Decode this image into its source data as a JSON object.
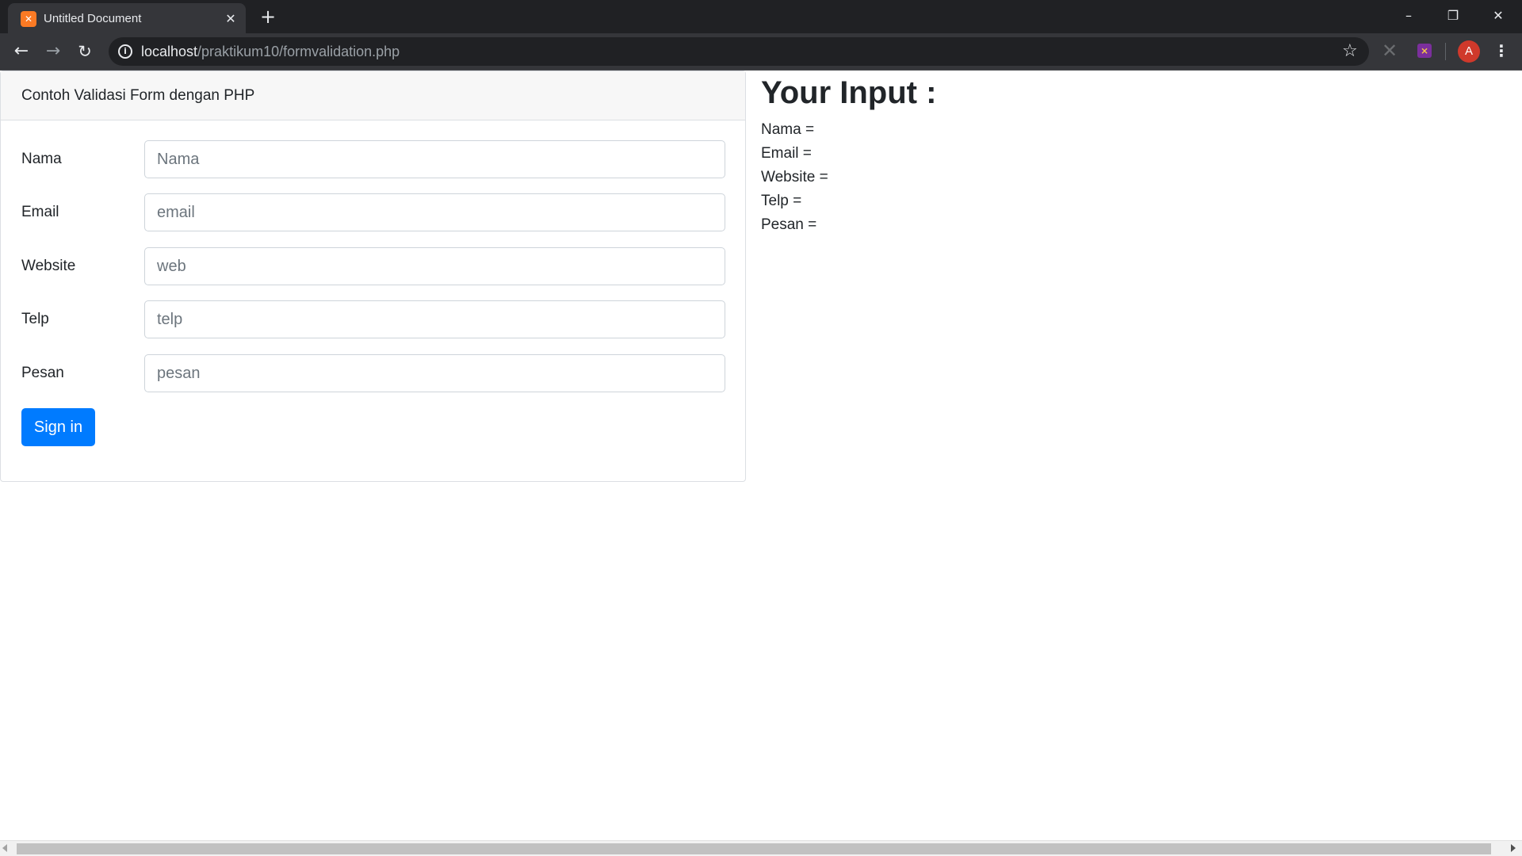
{
  "browser": {
    "tab_title": "Untitled Document",
    "tab_favicon": "xampp-icon",
    "tab_close": "✕",
    "new_tab": "+",
    "url_host": "localhost",
    "url_path": "/praktikum10/formvalidation.php",
    "avatar_letter": "A",
    "icons": {
      "back": "←",
      "forward": "→",
      "reload": "↻",
      "info": "i",
      "star": "☆",
      "extension_x": "✕",
      "menu": "⋮",
      "minimize": "–",
      "maximize": "❐",
      "close": "✕"
    }
  },
  "form": {
    "header_title": "Contoh Validasi Form dengan PHP",
    "fields": [
      {
        "label": "Nama",
        "placeholder": "Nama",
        "value": ""
      },
      {
        "label": "Email",
        "placeholder": "email",
        "value": ""
      },
      {
        "label": "Website",
        "placeholder": "web",
        "value": ""
      },
      {
        "label": "Telp",
        "placeholder": "telp",
        "value": ""
      },
      {
        "label": "Pesan",
        "placeholder": "pesan",
        "value": ""
      }
    ],
    "submit_label": "Sign in"
  },
  "result": {
    "title": "Your Input :",
    "lines": [
      "Nama =",
      "Email =",
      "Website =",
      "Telp =",
      "Pesan ="
    ]
  },
  "colors": {
    "primary": "#007bff",
    "tab_bg": "#35363a",
    "frame_bg": "#202124",
    "card_header_bg": "#f7f7f7"
  }
}
